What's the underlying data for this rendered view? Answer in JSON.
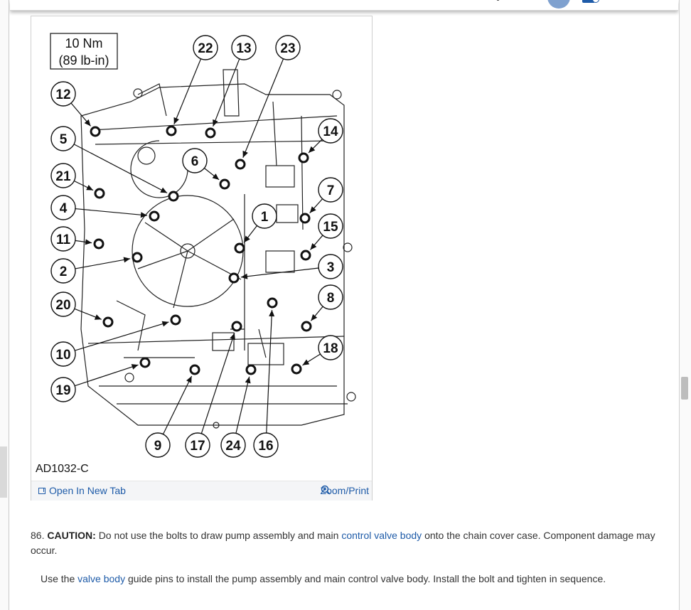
{
  "figure": {
    "torque_line1": "10 Nm",
    "torque_line2": "(89 lb-in)",
    "figure_id": "AD1032-C",
    "open_in_new_tab": "Open In New Tab",
    "zoom_print": "Zoom/Print",
    "callouts": [
      "1",
      "2",
      "3",
      "4",
      "5",
      "6",
      "7",
      "8",
      "9",
      "10",
      "11",
      "12",
      "13",
      "14",
      "15",
      "16",
      "17",
      "18",
      "19",
      "20",
      "21",
      "22",
      "23",
      "24"
    ]
  },
  "step": {
    "number": "86.",
    "caution_label": "CAUTION:",
    "text_before_link": "Do not use the bolts to draw pump assembly and main",
    "link1": "control valve body",
    "text_after_link": "onto the chain cover case. Component damage may occur."
  },
  "instruction": {
    "text_before_link": "Use the",
    "link": "valve body",
    "text_after_link": "guide pins to install the pump assembly and main control valve body. Install the bolt and tighten in sequence."
  },
  "colors": {
    "link": "#1e5ba8",
    "text": "#333333",
    "accent": "#7fa1cf"
  }
}
